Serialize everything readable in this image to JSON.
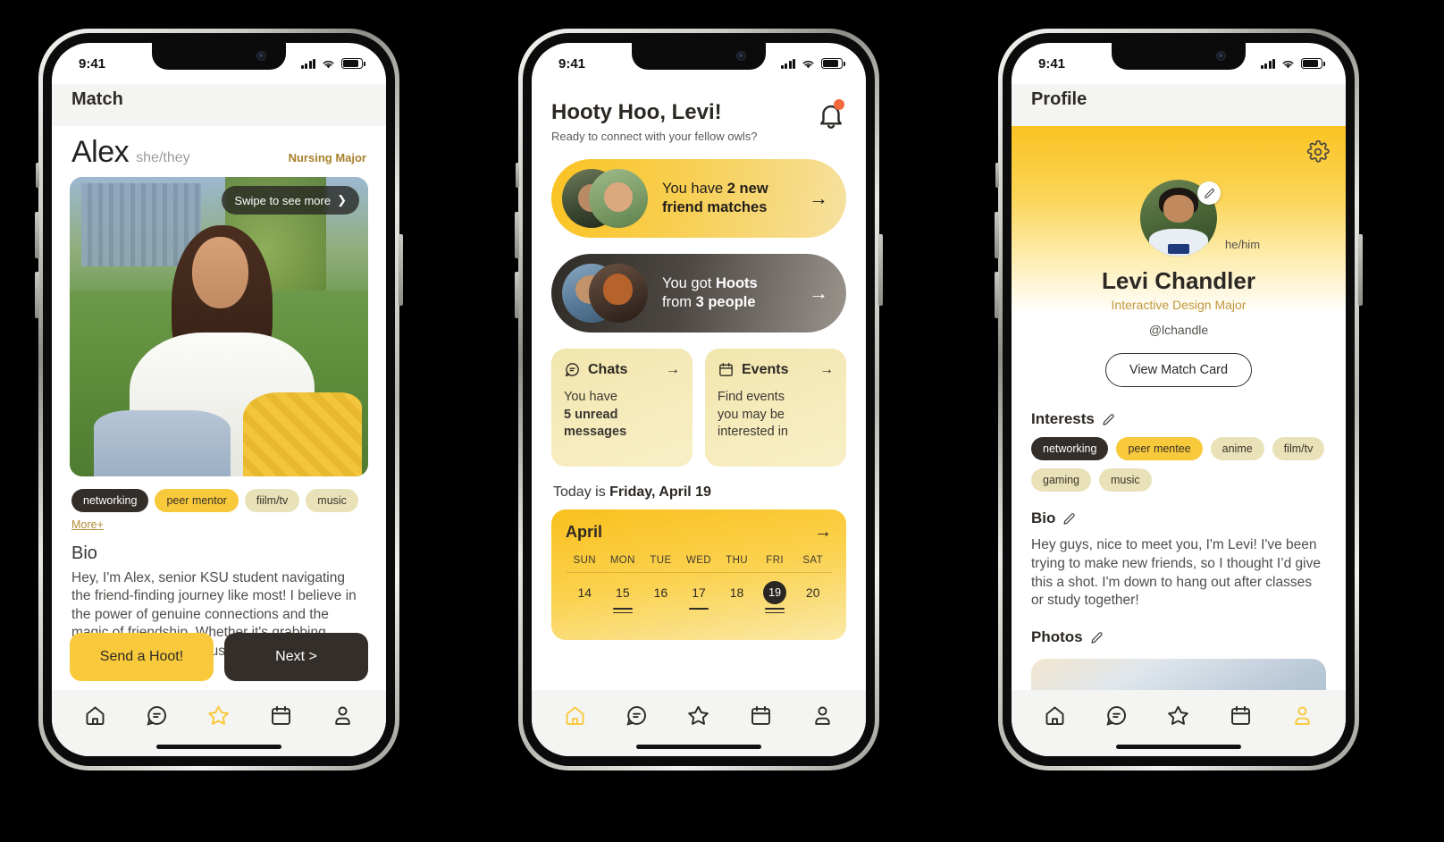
{
  "status_bar": {
    "time": "9:41",
    "signal_icon": "cellular-bars-icon",
    "wifi_icon": "wifi-icon",
    "battery_icon": "battery-icon"
  },
  "phone1": {
    "header_title": "Match",
    "profile": {
      "name": "Alex",
      "pronouns": "she/they",
      "major": "Nursing Major",
      "swipe_hint": "Swipe to see more",
      "swipe_chevron": "❯",
      "tags": [
        "networking",
        "peer mentor",
        "fiilm/tv",
        "music"
      ],
      "more_label": "More+",
      "bio_heading": "Bio",
      "bio_text": "Hey, I'm Alex, senior KSU student navigating the friend-finding journey like most! I believe in the power of genuine connections and the magic of friendship. Whether it's grabbing coffee, exploring campus, or just vibing"
    },
    "actions": {
      "primary": "Send a Hoot!",
      "secondary": "Next >"
    },
    "active_tab": "star"
  },
  "phone2": {
    "greeting_title": "Hooty Hoo, Levi!",
    "greeting_subtitle": "Ready to connect with your fellow owls?",
    "bell_icon": "bell-icon",
    "bell_has_badge": true,
    "matches_card": {
      "text_plain_1": "You have ",
      "text_bold_1": "2 new",
      "text_bold_2": "friend matches",
      "arrow": "→"
    },
    "hoots_card": {
      "text_plain_1": "You got ",
      "text_bold_1": "Hoots",
      "text_plain_2": "from ",
      "text_bold_2": "3 people",
      "arrow": "→"
    },
    "chats_card": {
      "title": "Chats",
      "icon": "chat-bubble-icon",
      "arrow": "→",
      "line1": "You have",
      "line2": "5 unread",
      "line3": "messages"
    },
    "events_card": {
      "title": "Events",
      "icon": "calendar-icon",
      "arrow": "→",
      "line1": "Find events",
      "line2": "you may be",
      "line3": "interested in"
    },
    "today_prefix": "Today is ",
    "today_date": "Friday, April 19",
    "calendar": {
      "month": "April",
      "arrow": "→",
      "dow": [
        "SUN",
        "MON",
        "TUE",
        "WED",
        "THU",
        "FRI",
        "SAT"
      ],
      "days": [
        {
          "n": "14",
          "selected": false,
          "marks": 0
        },
        {
          "n": "15",
          "selected": false,
          "marks": 2
        },
        {
          "n": "16",
          "selected": false,
          "marks": 0
        },
        {
          "n": "17",
          "selected": false,
          "marks": 1
        },
        {
          "n": "18",
          "selected": false,
          "marks": 0
        },
        {
          "n": "19",
          "selected": true,
          "marks": 2
        },
        {
          "n": "20",
          "selected": false,
          "marks": 0
        }
      ]
    },
    "active_tab": "home"
  },
  "phone3": {
    "header_title": "Profile",
    "gear_icon": "gear-icon",
    "edit_icon": "pencil-icon",
    "name": "Levi Chandler",
    "pronouns": "he/him",
    "major": "Interactive Design Major",
    "handle": "@lchandle",
    "match_card_button": "View Match Card",
    "interests_heading": "Interests",
    "interests": [
      "networking",
      "peer mentee",
      "anime",
      "film/tv",
      "gaming",
      "music"
    ],
    "bio_heading": "Bio",
    "bio_text": "Hey guys, nice to meet you, I'm Levi! I've been trying to make new friends, so I thought I’d give this a shot. I'm down to hang out after classes or study together!",
    "photos_heading": "Photos",
    "active_tab": "person"
  },
  "tab_items": [
    "home",
    "chats",
    "match",
    "events",
    "profile"
  ],
  "colors": {
    "brand_yellow": "#f8c93b",
    "deep_gold": "#fac322",
    "dark": "#332e29",
    "pale_tag": "#e9e2b8",
    "accent_gold_text": "#a8802c",
    "notification_red": "#f4683a"
  }
}
